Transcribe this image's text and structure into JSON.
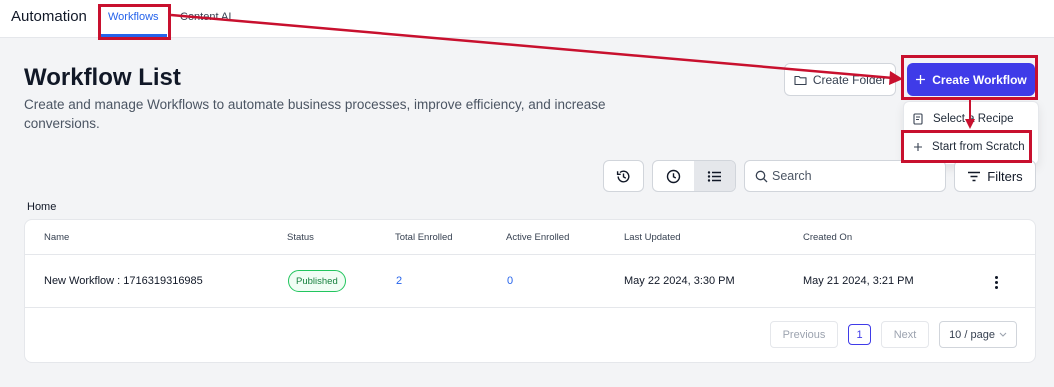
{
  "header": {
    "app_title": "Automation",
    "tabs": [
      {
        "label": "Workflows",
        "active": true
      },
      {
        "label": "Content AI",
        "active": false
      }
    ]
  },
  "page": {
    "title": "Workflow List",
    "description": "Create and manage Workflows to automate business processes, improve efficiency, and increase conversions."
  },
  "actions": {
    "create_folder": "Create Folder",
    "create_workflow": "Create Workflow",
    "dropdown": [
      {
        "label": "Select a Recipe",
        "icon": "recipe-icon"
      },
      {
        "label": "Start from Scratch",
        "icon": "plus-icon"
      }
    ]
  },
  "toolbar": {
    "search_placeholder": "Search",
    "filters": "Filters"
  },
  "breadcrumb": "Home",
  "table": {
    "columns": [
      "Name",
      "Status",
      "Total Enrolled",
      "Active Enrolled",
      "Last Updated",
      "Created On"
    ],
    "rows": [
      {
        "name": "New Workflow : 1716319316985",
        "status": "Published",
        "total_enrolled": "2",
        "active_enrolled": "0",
        "last_updated": "May 22 2024, 3:30 PM",
        "created_on": "May 21 2024, 3:21 PM"
      }
    ]
  },
  "pagination": {
    "previous": "Previous",
    "current_page": "1",
    "next": "Next",
    "page_size": "10 / page"
  },
  "colors": {
    "primary": "#3f3be8",
    "link": "#2563eb",
    "annotation": "#c8102e",
    "published": "#22c55e"
  }
}
